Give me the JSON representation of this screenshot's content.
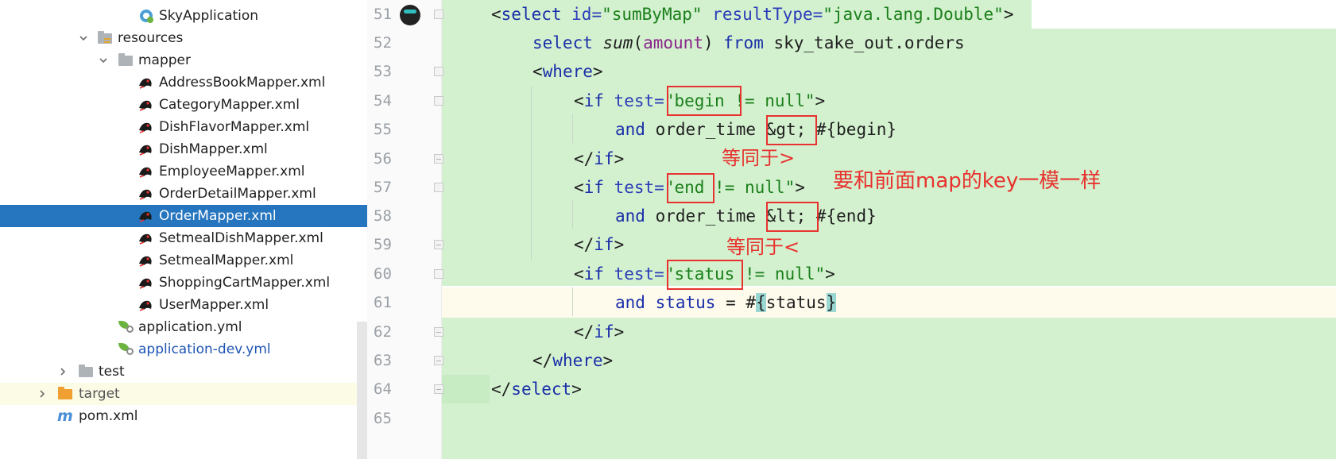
{
  "project_tree": {
    "items": [
      {
        "label": "SkyApplication",
        "icon": "spring-boot-app-icon"
      },
      {
        "label": "resources",
        "icon": "resources-folder-icon"
      },
      {
        "label": "mapper",
        "icon": "folder-icon"
      },
      {
        "label": "AddressBookMapper.xml",
        "icon": "mybatis-xml-icon"
      },
      {
        "label": "CategoryMapper.xml",
        "icon": "mybatis-xml-icon"
      },
      {
        "label": "DishFlavorMapper.xml",
        "icon": "mybatis-xml-icon"
      },
      {
        "label": "DishMapper.xml",
        "icon": "mybatis-xml-icon"
      },
      {
        "label": "EmployeeMapper.xml",
        "icon": "mybatis-xml-icon"
      },
      {
        "label": "OrderDetailMapper.xml",
        "icon": "mybatis-xml-icon"
      },
      {
        "label": "OrderMapper.xml",
        "icon": "mybatis-xml-icon",
        "selected": true
      },
      {
        "label": "SetmealDishMapper.xml",
        "icon": "mybatis-xml-icon"
      },
      {
        "label": "SetmealMapper.xml",
        "icon": "mybatis-xml-icon"
      },
      {
        "label": "ShoppingCartMapper.xml",
        "icon": "mybatis-xml-icon"
      },
      {
        "label": "UserMapper.xml",
        "icon": "mybatis-xml-icon"
      },
      {
        "label": "application.yml",
        "icon": "spring-config-icon"
      },
      {
        "label": "application-dev.yml",
        "icon": "spring-config-icon"
      },
      {
        "label": "test",
        "icon": "folder-icon"
      },
      {
        "label": "target",
        "icon": "excluded-folder-icon"
      },
      {
        "label": "pom.xml",
        "icon": "maven-icon"
      }
    ]
  },
  "editor": {
    "line_numbers": [
      "51",
      "52",
      "53",
      "54",
      "55",
      "56",
      "57",
      "58",
      "59",
      "60",
      "61",
      "62",
      "63",
      "64",
      "65"
    ],
    "lines": {
      "l51": {
        "open": "<",
        "tag": "select",
        "a1": " id=",
        "v1": "\"sumByMap\"",
        "a2": " resultType=",
        "v2": "\"java.lang.Double\"",
        "close": ">"
      },
      "l52": {
        "kw1": "select ",
        "fn": "sum",
        "p1": "(",
        "col": "amount",
        "p2": ") ",
        "kw2": "from",
        "rest": " sky_take_out.orders"
      },
      "l53": {
        "open": "<",
        "tag": "where",
        "close": ">"
      },
      "l54": {
        "open": "<",
        "tag": "if",
        "a1": " test=",
        "q": "\"",
        "var": "begin",
        "cond": " != null",
        "q2": "\"",
        "close": ">"
      },
      "l55": {
        "kw": "and",
        "mid": " order_time ",
        "ent": "&gt;",
        "expr": " #{begin}"
      },
      "l56": {
        "open": "</",
        "tag": "if",
        "close": ">"
      },
      "l57": {
        "open": "<",
        "tag": "if",
        "a1": " test=",
        "q": "\"",
        "var": "end",
        "cond": " != null",
        "q2": "\"",
        "close": ">"
      },
      "l58": {
        "kw": "and",
        "mid": " order_time ",
        "ent": "&lt;",
        "expr": " #{end}"
      },
      "l59": {
        "open": "</",
        "tag": "if",
        "close": ">"
      },
      "l60": {
        "open": "<",
        "tag": "if",
        "a1": " test=",
        "q": "\"",
        "var": "status",
        "cond": " != null",
        "q2": "\"",
        "close": ">"
      },
      "l61": {
        "kw": "and",
        "col": " status",
        "eq": " = ",
        "hash": "#",
        "lb": "{",
        "var": "status",
        "rb": "}"
      },
      "l62": {
        "open": "</",
        "tag": "if",
        "close": ">"
      },
      "l63": {
        "open": "</",
        "tag": "where",
        "close": ">"
      },
      "l64": {
        "open": "</",
        "tag": "select",
        "close": ">"
      }
    }
  },
  "annotations": {
    "gt_note": "等同于>",
    "lt_note": "等同于<",
    "key_note": "要和前面map的key一模一样"
  },
  "colors": {
    "annotation": "#e8322f",
    "selection": "#2675bf",
    "diff_added": "#d3f1cf"
  }
}
